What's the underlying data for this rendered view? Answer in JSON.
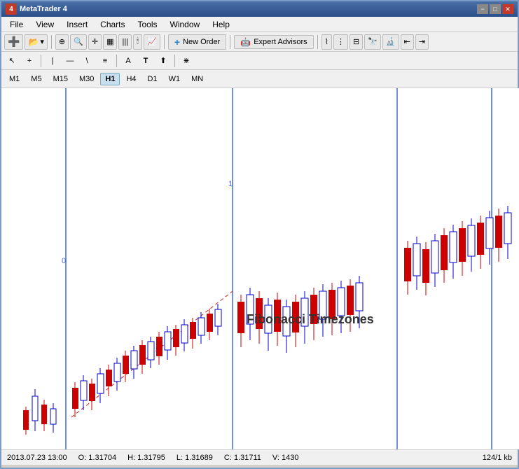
{
  "window": {
    "title": "MetaTrader 4",
    "min_btn": "−",
    "max_btn": "□",
    "close_btn": "✕"
  },
  "menu": {
    "items": [
      "File",
      "View",
      "Insert",
      "Charts",
      "Tools",
      "Window",
      "Help"
    ]
  },
  "toolbar1": {
    "new_order_label": "New Order",
    "expert_advisors_label": "Expert Advisors"
  },
  "timeframes": {
    "items": [
      "M1",
      "M5",
      "M15",
      "M30",
      "H1",
      "H4",
      "D1",
      "W1",
      "MN"
    ]
  },
  "chart": {
    "fib_label": "Fibonacci Timezones",
    "label_0": "0",
    "label_1": "1"
  },
  "status": {
    "date": "2013.07.23 13:00",
    "open": "O: 1.31704",
    "high": "H: 1.31795",
    "low": "L: 1.31689",
    "close": "C: 1.31711",
    "volume": "V: 1430",
    "info": "124/1 kb"
  }
}
